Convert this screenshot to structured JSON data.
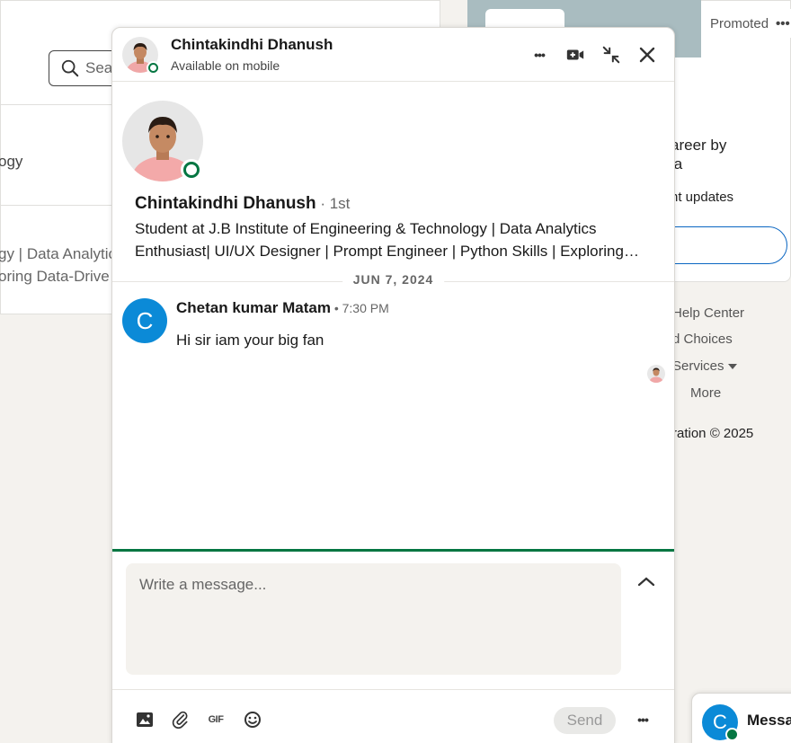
{
  "background": {
    "search_placeholder": "Sear",
    "left_line1": "ogy",
    "left_line2": "gy | Data Analytic",
    "left_line3": "oring Data-Drive",
    "promoted_label": "Promoted",
    "promoted_more": "•••",
    "ad_title_line1": "areer by",
    "ad_title_line2": "ia",
    "ad_subtitle": "nt updates",
    "footer": {
      "help_center": "Help Center",
      "ad_choices": "d Choices",
      "services": "Services",
      "more": "More",
      "copyright": "ration © 2025"
    }
  },
  "chat": {
    "header": {
      "name": "Chintakindhi Dhanush",
      "status": "Available on mobile",
      "more_label": "•••"
    },
    "profile": {
      "name": "Chintakindhi Dhanush",
      "degree": " · 1st",
      "headline_line1": "Student at J.B Institute of Engineering & Technology | Data Analytics",
      "headline_line2": "Enthusiast| UI/UX Designer | Prompt Engineer | Python Skills | Exploring Data-Driven Solutions"
    },
    "date_divider": "JUN 7, 2024",
    "messages": [
      {
        "sender": "Chetan kumar Matam",
        "initial": "C",
        "time": " • 7:30 PM",
        "text": "Hi sir iam your big fan"
      }
    ],
    "composer": {
      "placeholder": "Write a message...",
      "gif_label": "GIF",
      "send_label": "Send",
      "more_label": "•••"
    }
  },
  "messaging_bar": {
    "initial": "C",
    "label": "Messa"
  },
  "colors": {
    "accent_green": "#057642",
    "avatar_blue": "#0b8ad7",
    "link_blue": "#0a66c2"
  }
}
